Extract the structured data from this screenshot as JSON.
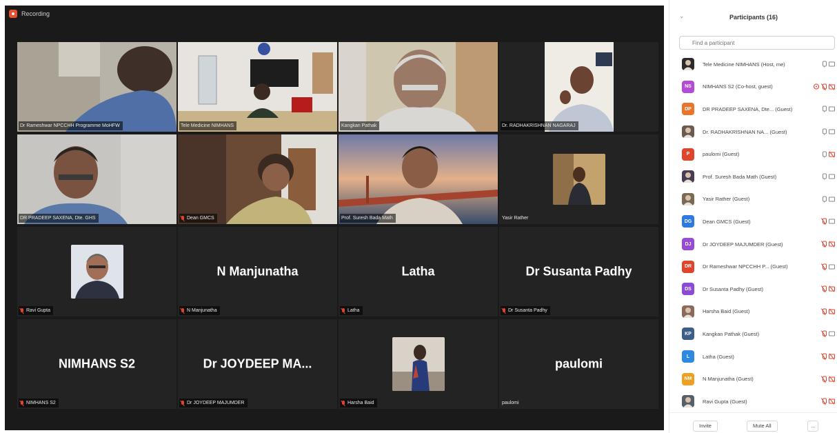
{
  "recording": {
    "label": "Recording"
  },
  "tiles": [
    {
      "plate": "Dr Rameshwar NPCCHH Programme MoHFW",
      "big": "",
      "mic_off": false
    },
    {
      "plate": "Tele Medicine NIMHANS",
      "big": "",
      "mic_off": false
    },
    {
      "plate": "Kangkan Pathak",
      "big": "",
      "mic_off": false
    },
    {
      "plate": "Dr. RADHAKRISHNAN NAGARAJ",
      "big": "",
      "mic_off": false
    },
    {
      "plate": "DR PRADEEP SAXENA, Dte. GHS",
      "big": "",
      "mic_off": false
    },
    {
      "plate": "Dean GMCS",
      "big": "",
      "mic_off": true
    },
    {
      "plate": "Prof. Suresh Bada Math",
      "big": "",
      "mic_off": false
    },
    {
      "plate": "Yasir Rather",
      "big": "",
      "mic_off": false
    },
    {
      "plate": "Ravi Gupta",
      "big": "",
      "mic_off": true
    },
    {
      "plate": "N Manjunatha",
      "big": "N Manjunatha",
      "mic_off": true
    },
    {
      "plate": "Latha",
      "big": "Latha",
      "mic_off": true
    },
    {
      "plate": "Dr Susanta Padhy",
      "big": "Dr Susanta Padhy",
      "mic_off": true
    },
    {
      "plate": "NIMHANS S2",
      "big": "NIMHANS S2",
      "mic_off": true
    },
    {
      "plate": "Dr JOYDEEP MAJUMDER",
      "big": "Dr JOYDEEP MA...",
      "mic_off": true
    },
    {
      "plate": "Harsha Baid",
      "big": "",
      "mic_off": true
    },
    {
      "plate": "paulomi",
      "big": "paulomi",
      "mic_off": false
    }
  ],
  "panel": {
    "collapse": "⌄",
    "title": "Participants (16)",
    "search_placeholder": "Find a participant",
    "participants": [
      {
        "name": "Tele Medicine NIMHANS (Host, me)",
        "initials": "",
        "color": "#2b2b2b",
        "photo": true,
        "mic": "on",
        "cam": "on",
        "share": false
      },
      {
        "name": "NIMHANS S2 (Co-host, guest)",
        "initials": "NS",
        "color": "#b34bd6",
        "photo": false,
        "mic": "off",
        "cam": "off",
        "share": true
      },
      {
        "name": "DR PRADEEP SAXENA, Dte... (Guest)",
        "initials": "DP",
        "color": "#e8752b",
        "photo": false,
        "mic": "on",
        "cam": "on",
        "share": false
      },
      {
        "name": "Dr. RADHAKRISHNAN NA... (Guest)",
        "initials": "",
        "color": "#6b5b4e",
        "photo": true,
        "mic": "on",
        "cam": "on",
        "share": false
      },
      {
        "name": "paulomi (Guest)",
        "initials": "P",
        "color": "#e0452c",
        "photo": false,
        "mic": "on",
        "cam": "off",
        "share": false
      },
      {
        "name": "Prof. Suresh Bada Math (Guest)",
        "initials": "",
        "color": "#4a3d52",
        "photo": true,
        "mic": "on",
        "cam": "on",
        "share": false
      },
      {
        "name": "Yasir Rather (Guest)",
        "initials": "",
        "color": "#7a6a52",
        "photo": true,
        "mic": "on",
        "cam": "on",
        "share": false
      },
      {
        "name": "Dean GMCS (Guest)",
        "initials": "DG",
        "color": "#2d7be0",
        "photo": false,
        "mic": "off",
        "cam": "on",
        "share": false
      },
      {
        "name": "Dr JOYDEEP MAJUMDER (Guest)",
        "initials": "DJ",
        "color": "#9a4bd6",
        "photo": false,
        "mic": "off",
        "cam": "off",
        "share": false
      },
      {
        "name": "Dr Rameshwar NPCCHH P... (Guest)",
        "initials": "DR",
        "color": "#e0452c",
        "photo": false,
        "mic": "off",
        "cam": "on",
        "share": false
      },
      {
        "name": "Dr Susanta Padhy (Guest)",
        "initials": "DS",
        "color": "#8c4bd6",
        "photo": false,
        "mic": "off",
        "cam": "off",
        "share": false
      },
      {
        "name": "Harsha Baid (Guest)",
        "initials": "",
        "color": "#8a6b5a",
        "photo": true,
        "mic": "off",
        "cam": "off",
        "share": false
      },
      {
        "name": "Kangkan Pathak (Guest)",
        "initials": "KP",
        "color": "#3c5f8a",
        "photo": false,
        "mic": "off",
        "cam": "on",
        "share": false
      },
      {
        "name": "Latha (Guest)",
        "initials": "L",
        "color": "#2d8ae0",
        "photo": false,
        "mic": "off",
        "cam": "off",
        "share": false
      },
      {
        "name": "N Manjunatha (Guest)",
        "initials": "NM",
        "color": "#f0a020",
        "photo": false,
        "mic": "off",
        "cam": "off",
        "share": false
      },
      {
        "name": "Ravi Gupta (Guest)",
        "initials": "",
        "color": "#55606a",
        "photo": true,
        "mic": "off",
        "cam": "off",
        "share": false
      }
    ],
    "invite": "Invite",
    "mute_all": "Mute All",
    "more": "..."
  }
}
